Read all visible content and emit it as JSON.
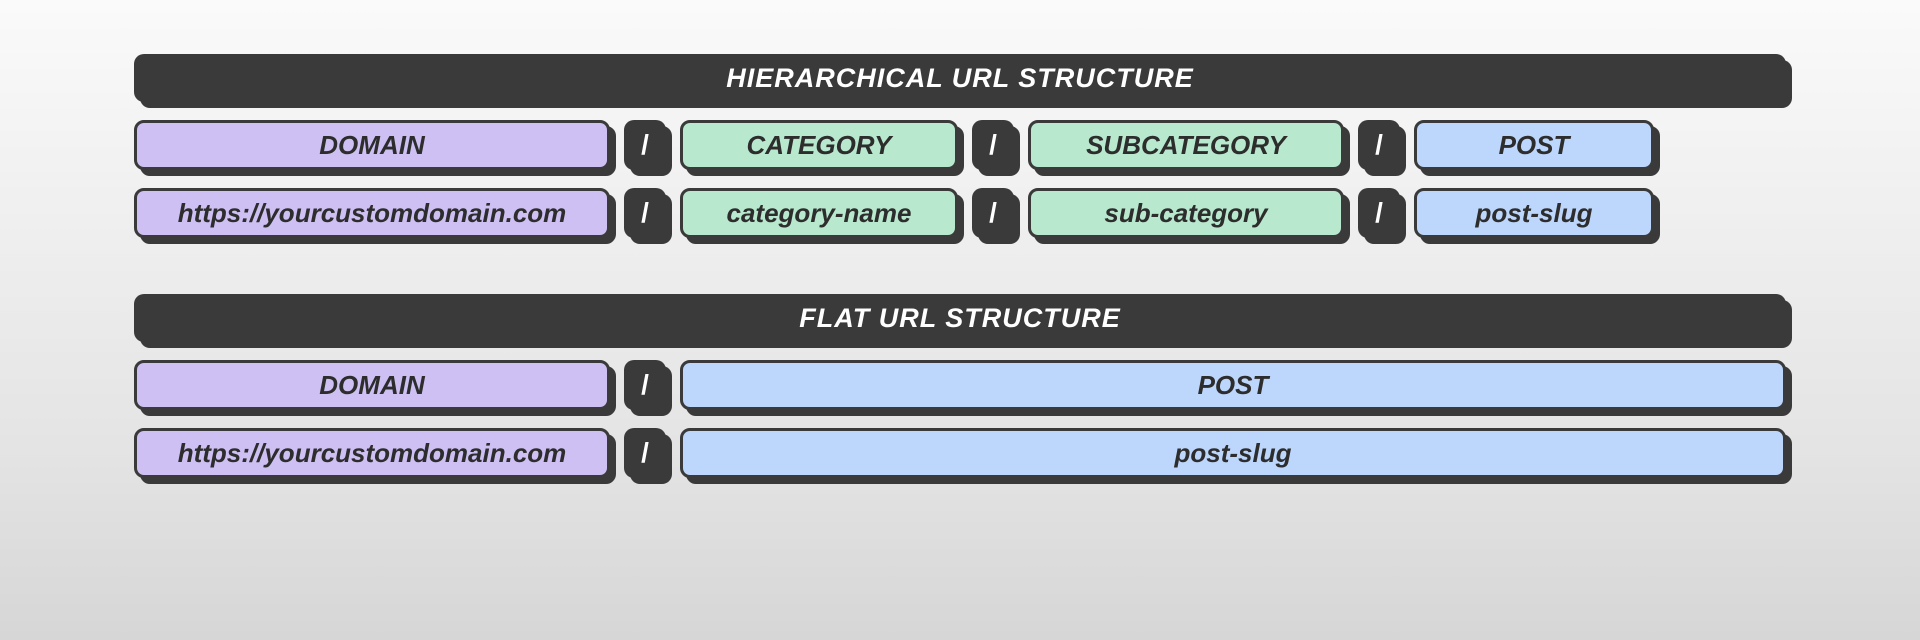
{
  "colors": {
    "domain": "#cfc0f4",
    "category": "#b8e8cd",
    "post": "#bdd6fb",
    "frame": "#3a3a3a"
  },
  "slash": "/",
  "hierarchical": {
    "title": "HIERARCHICAL URL STRUCTURE",
    "labels": {
      "domain": "DOMAIN",
      "category": "CATEGORY",
      "subcategory": "SUBCATEGORY",
      "post": "POST"
    },
    "values": {
      "domain": "https://yourcustomdomain.com",
      "category": "category-name",
      "subcategory": "sub-category",
      "post": "post-slug"
    }
  },
  "flat": {
    "title": "FLAT URL STRUCTURE",
    "labels": {
      "domain": "DOMAIN",
      "post": "POST"
    },
    "values": {
      "domain": "https://yourcustomdomain.com",
      "post": "post-slug"
    }
  }
}
